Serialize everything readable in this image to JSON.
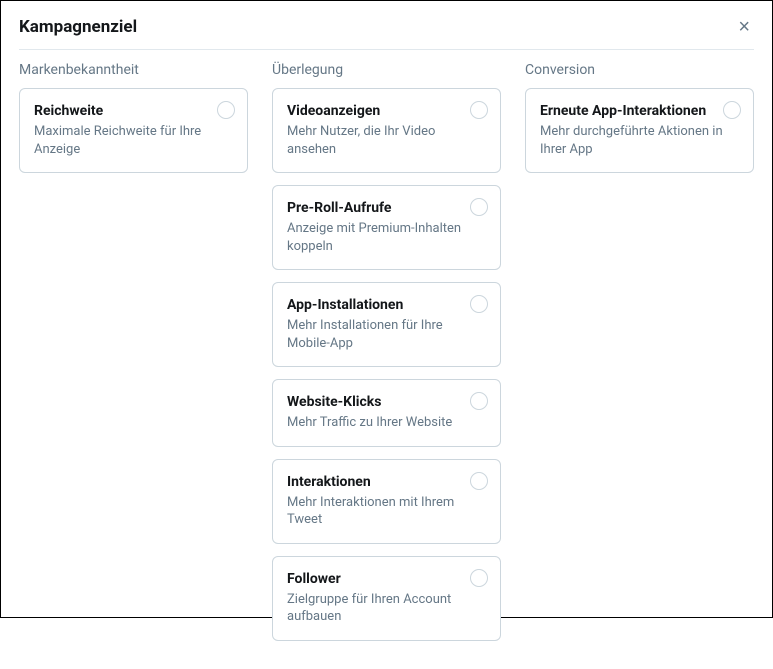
{
  "header": {
    "title": "Kampagnenziel"
  },
  "columns": [
    {
      "header": "Markenbekanntheit",
      "options": [
        {
          "title": "Reichweite",
          "desc": "Maximale Reichweite für Ihre Anzeige"
        }
      ]
    },
    {
      "header": "Überlegung",
      "options": [
        {
          "title": "Videoanzeigen",
          "desc": "Mehr Nutzer, die Ihr Video ansehen"
        },
        {
          "title": "Pre-Roll-Aufrufe",
          "desc": "Anzeige mit Premium-Inhalten koppeln"
        },
        {
          "title": "App-Installationen",
          "desc": "Mehr Installationen für Ihre Mobile-App"
        },
        {
          "title": "Website-Klicks",
          "desc": "Mehr Traffic zu Ihrer Website"
        },
        {
          "title": "Interaktionen",
          "desc": "Mehr Interaktionen mit Ihrem Tweet"
        },
        {
          "title": "Follower",
          "desc": "Zielgruppe für Ihren Account aufbauen"
        }
      ]
    },
    {
      "header": "Conversion",
      "options": [
        {
          "title": "Erneute App-Interaktionen",
          "desc": "Mehr durchgeführte Aktionen in Ihrer App"
        }
      ]
    }
  ]
}
